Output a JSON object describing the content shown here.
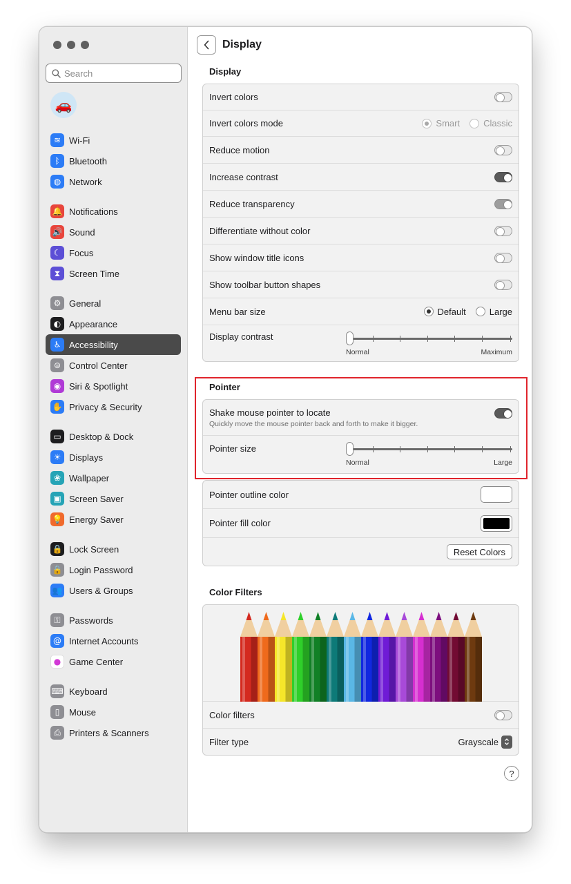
{
  "sidebar": {
    "search_placeholder": "Search",
    "avatar": "🚗",
    "groups": [
      [
        {
          "label": "Wi-Fi",
          "icon": "wifi-icon",
          "color": "#2c7cf6",
          "glyph": "≋"
        },
        {
          "label": "Bluetooth",
          "icon": "bluetooth-icon",
          "color": "#2c7cf6",
          "glyph": "ᛒ"
        },
        {
          "label": "Network",
          "icon": "network-icon",
          "color": "#2c7cf6",
          "glyph": "◍"
        }
      ],
      [
        {
          "label": "Notifications",
          "icon": "notifications-icon",
          "color": "#e8453c",
          "glyph": "🔔"
        },
        {
          "label": "Sound",
          "icon": "sound-icon",
          "color": "#e8453c",
          "glyph": "🔊"
        },
        {
          "label": "Focus",
          "icon": "focus-icon",
          "color": "#5c4fd6",
          "glyph": "☾"
        },
        {
          "label": "Screen Time",
          "icon": "screen-time-icon",
          "color": "#5c4fd6",
          "glyph": "⧗"
        }
      ],
      [
        {
          "label": "General",
          "icon": "gear-icon",
          "color": "#8e8e93",
          "glyph": "⚙"
        },
        {
          "label": "Appearance",
          "icon": "appearance-icon",
          "color": "#1d1d1f",
          "glyph": "◐"
        },
        {
          "label": "Accessibility",
          "icon": "accessibility-icon",
          "color": "#2c7cf6",
          "glyph": "♿",
          "active": true
        },
        {
          "label": "Control Center",
          "icon": "control-center-icon",
          "color": "#8e8e93",
          "glyph": "⊜"
        },
        {
          "label": "Siri & Spotlight",
          "icon": "siri-icon",
          "color": "#b03ad6",
          "glyph": "◉"
        },
        {
          "label": "Privacy & Security",
          "icon": "privacy-hand-icon",
          "color": "#2c7cf6",
          "glyph": "✋"
        }
      ],
      [
        {
          "label": "Desktop & Dock",
          "icon": "desktop-dock-icon",
          "color": "#1d1d1f",
          "glyph": "▭"
        },
        {
          "label": "Displays",
          "icon": "displays-icon",
          "color": "#2c7cf6",
          "glyph": "☀"
        },
        {
          "label": "Wallpaper",
          "icon": "wallpaper-icon",
          "color": "#26a4b6",
          "glyph": "❀"
        },
        {
          "label": "Screen Saver",
          "icon": "screen-saver-icon",
          "color": "#26a4b6",
          "glyph": "▣"
        },
        {
          "label": "Energy Saver",
          "icon": "energy-saver-icon",
          "color": "#f06a2c",
          "glyph": "💡"
        }
      ],
      [
        {
          "label": "Lock Screen",
          "icon": "lock-screen-icon",
          "color": "#1d1d1f",
          "glyph": "🔒"
        },
        {
          "label": "Login Password",
          "icon": "lock-icon",
          "color": "#8e8e93",
          "glyph": "🔒"
        },
        {
          "label": "Users & Groups",
          "icon": "users-icon",
          "color": "#2c7cf6",
          "glyph": "👥"
        }
      ],
      [
        {
          "label": "Passwords",
          "icon": "key-icon",
          "color": "#8e8e93",
          "glyph": "⚿"
        },
        {
          "label": "Internet Accounts",
          "icon": "at-icon",
          "color": "#2c7cf6",
          "glyph": "@"
        },
        {
          "label": "Game Center",
          "icon": "game-center-icon",
          "color": "#ffffff",
          "glyph": "●"
        }
      ],
      [
        {
          "label": "Keyboard",
          "icon": "keyboard-icon",
          "color": "#8e8e93",
          "glyph": "⌨"
        },
        {
          "label": "Mouse",
          "icon": "mouse-icon",
          "color": "#8e8e93",
          "glyph": "▯"
        },
        {
          "label": "Printers & Scanners",
          "icon": "printer-icon",
          "color": "#8e8e93",
          "glyph": "⎙"
        }
      ]
    ]
  },
  "header": {
    "title": "Display"
  },
  "display_section": {
    "title": "Display",
    "invert_colors": "Invert colors",
    "invert_mode": {
      "label": "Invert colors mode",
      "opt1": "Smart",
      "opt2": "Classic"
    },
    "reduce_motion": "Reduce motion",
    "increase_contrast": "Increase contrast",
    "reduce_transparency": "Reduce transparency",
    "differentiate": "Differentiate without color",
    "title_icons": "Show window title icons",
    "toolbar_shapes": "Show toolbar button shapes",
    "menu_bar": {
      "label": "Menu bar size",
      "opt1": "Default",
      "opt2": "Large"
    },
    "contrast": {
      "label": "Display contrast",
      "min": "Normal",
      "max": "Maximum"
    }
  },
  "pointer_section": {
    "title": "Pointer",
    "shake": "Shake mouse pointer to locate",
    "shake_desc": "Quickly move the mouse pointer back and forth to make it bigger.",
    "size": {
      "label": "Pointer size",
      "min": "Normal",
      "max": "Large"
    },
    "outline": "Pointer outline color",
    "outline_color": "#ffffff",
    "fill": "Pointer fill color",
    "fill_color": "#000000",
    "reset": "Reset Colors"
  },
  "color_filters": {
    "title": "Color Filters",
    "filters_label": "Color filters",
    "type_label": "Filter type",
    "type_value": "Grayscale",
    "pencil_colors": [
      "#d42a1f",
      "#ef6a1c",
      "#f5e62a",
      "#2fcf2a",
      "#118026",
      "#0d7a78",
      "#5ab7e6",
      "#1128e0",
      "#6f1bd6",
      "#a84ad8",
      "#d62fd0",
      "#7d0e7e",
      "#720b33",
      "#6e3a0f"
    ]
  },
  "help": "?"
}
